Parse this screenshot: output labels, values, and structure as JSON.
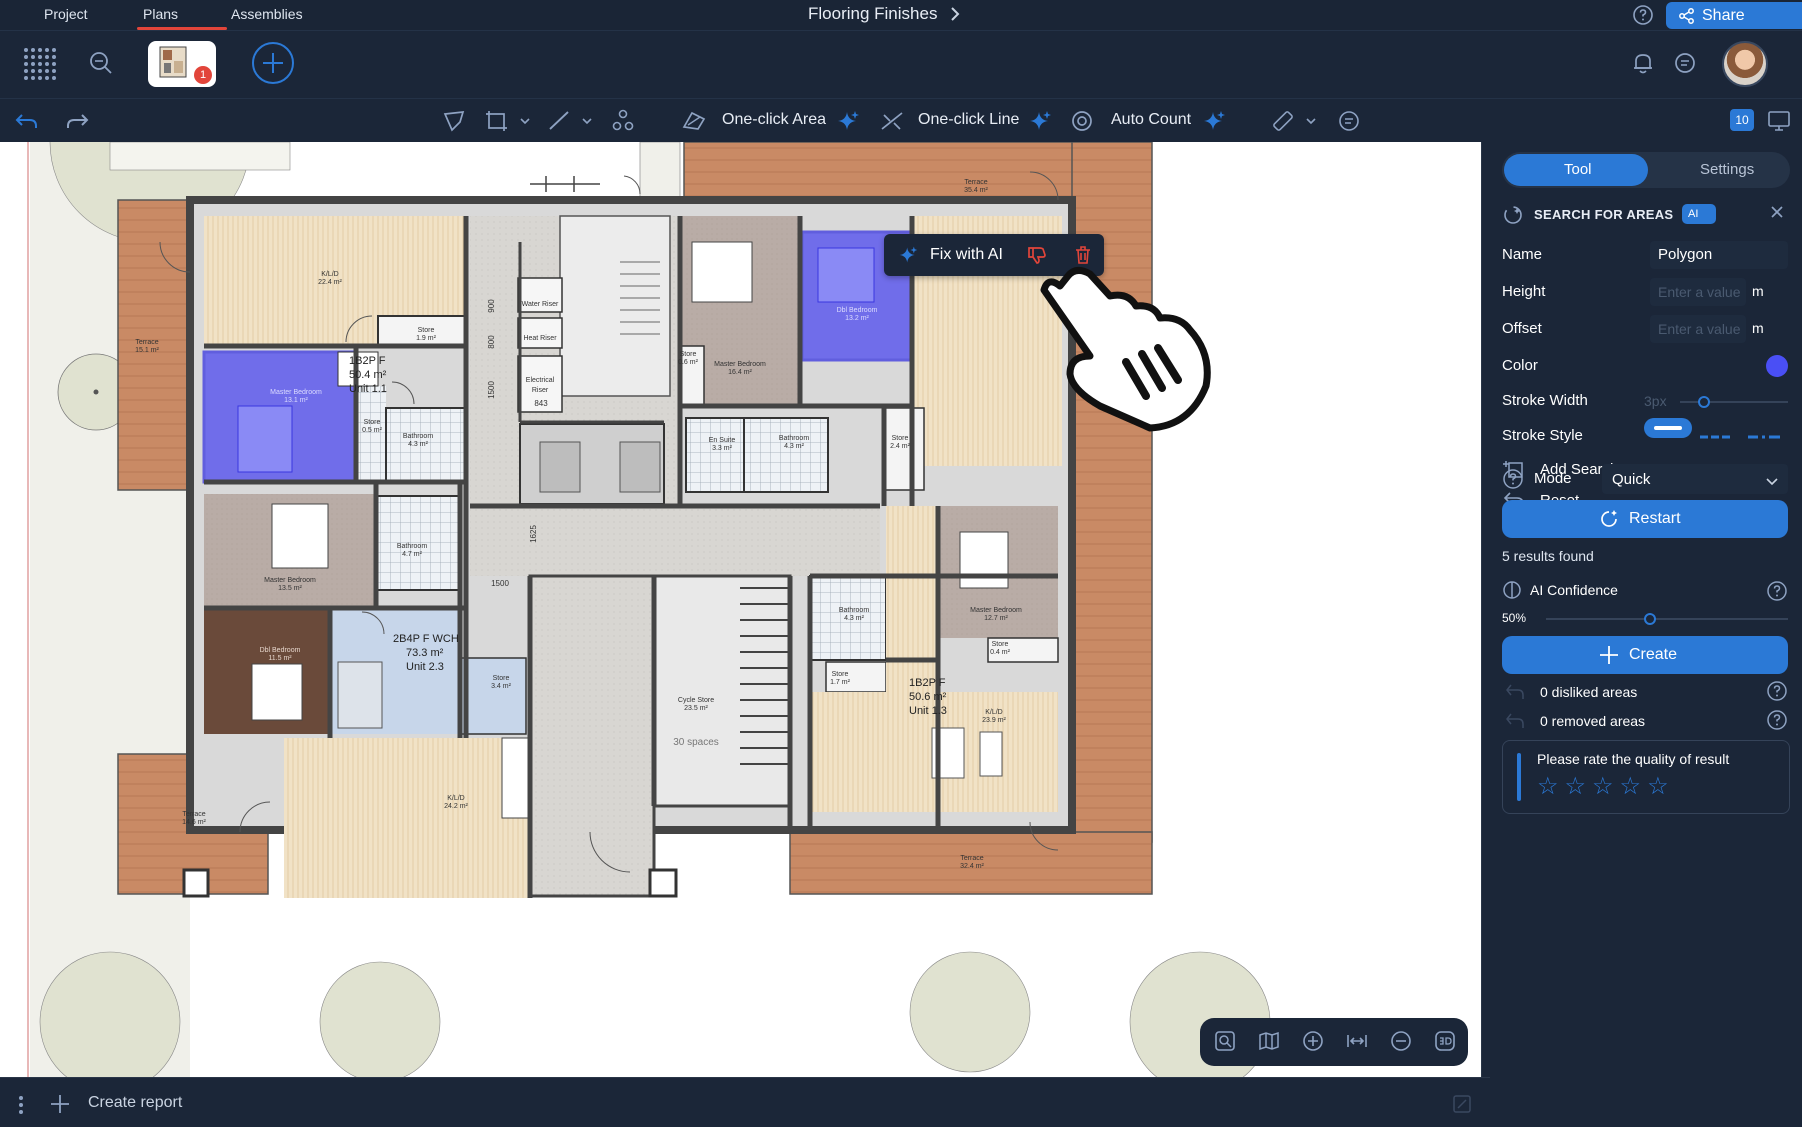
{
  "nav": {
    "tabs": [
      "Project",
      "Plans",
      "Assemblies"
    ],
    "active": "Plans"
  },
  "document": {
    "title": "Flooring Finishes"
  },
  "share": {
    "label": "Share"
  },
  "plan_thumbnail": {
    "badge": "1"
  },
  "toolbar": {
    "one_click_area": "One-click Area",
    "one_click_line": "One-click Line",
    "auto_count": "Auto Count",
    "count_badge": "10"
  },
  "popup": {
    "fix_label": "Fix with AI"
  },
  "plan": {
    "rooms": [
      {
        "name": "K/L/D",
        "area": "22.4 m²"
      },
      {
        "name": "Terrace",
        "area": "15.1 m²"
      },
      {
        "name": "Store",
        "area": "1.9 m²"
      },
      {
        "name": "Master Bedroom",
        "area": "13.1 m²"
      },
      {
        "name": "Store",
        "area": "0.5 m²"
      },
      {
        "name": "Bathroom",
        "area": "4.3 m²"
      },
      {
        "name": "Water Riser"
      },
      {
        "name": "Heat Riser"
      },
      {
        "name": "Electrical Riser"
      },
      {
        "name": "Store",
        "area": "0.6 m²"
      },
      {
        "name": "Master Bedroom",
        "area": "16.4 m²"
      },
      {
        "name": "Dbl Bedroom",
        "area": "13.2 m²"
      },
      {
        "name": "En Suite",
        "area": "3.3 m²"
      },
      {
        "name": "Bathroom",
        "area": "4.3 m²"
      },
      {
        "name": "Store",
        "area": "2.4 m²"
      },
      {
        "name": "Terrace",
        "area": "35.4 m²"
      },
      {
        "name": "Master Bedroom",
        "area": "13.5 m²"
      },
      {
        "name": "Bathroom",
        "area": "4.7 m²"
      },
      {
        "name": "Store",
        "area": "3.4 m²"
      },
      {
        "name": "Dbl Bedroom",
        "area": "11.5 m²"
      },
      {
        "name": "Terrace",
        "area": "14.6 m²"
      },
      {
        "name": "K/L/D",
        "area": "24.2 m²"
      },
      {
        "name": "Cycle Store",
        "area": "23.5 m²"
      },
      {
        "name": "Bathroom",
        "area": "4.3 m²"
      },
      {
        "name": "Master Bedroom",
        "area": "12.7 m²"
      },
      {
        "name": "Store",
        "area": "0.4 m²"
      },
      {
        "name": "Store",
        "area": "1.7 m²"
      },
      {
        "name": "K/L/D",
        "area": "23.9 m²"
      },
      {
        "name": "Terrace",
        "area": "32.4 m²"
      }
    ],
    "units": [
      {
        "type": "1B2P F",
        "area": "50.4 m²",
        "unit": "Unit 1.1"
      },
      {
        "type": "2B4P F WCH",
        "area": "73.3 m²",
        "unit": "Unit 2.3"
      },
      {
        "type": "1B2P F",
        "area": "50.6 m²",
        "unit": "Unit 1.3"
      }
    ],
    "dimensions": [
      "900",
      "800",
      "1500",
      "843",
      "1625",
      "1500"
    ],
    "cycle_spaces": "30 spaces"
  },
  "bottom": {
    "create_report": "Create report"
  },
  "panel": {
    "tabs": [
      "Tool",
      "Settings"
    ],
    "active_tab": "Tool",
    "search_title": "SEARCH FOR AREAS",
    "ai_badge": "AI",
    "name_label": "Name",
    "name_value": "Polygon",
    "height_label": "Height",
    "height_placeholder": "Enter a value",
    "height_unit": "m",
    "offset_label": "Offset",
    "offset_placeholder": "Enter a value",
    "offset_unit": "m",
    "color_label": "Color",
    "color_value": "#4a4ff5",
    "stroke_width_label": "Stroke Width",
    "stroke_width_value": "3px",
    "stroke_style_label": "Stroke Style",
    "add_search_zone": "Add Search Zone",
    "reset": "Reset",
    "mode_label": "Mode",
    "mode_value": "Quick",
    "restart": "Restart",
    "results": "5 results found",
    "ai_confidence_label": "AI Confidence",
    "ai_confidence_value": "50%",
    "create": "Create",
    "disliked": "0 disliked areas",
    "removed": "0 removed areas",
    "rate_prompt": "Please rate the quality of result",
    "stars": 5
  },
  "colors": {
    "accent": "#2b79d6",
    "alert": "#e2453a",
    "selection": "#4a4ff5"
  }
}
